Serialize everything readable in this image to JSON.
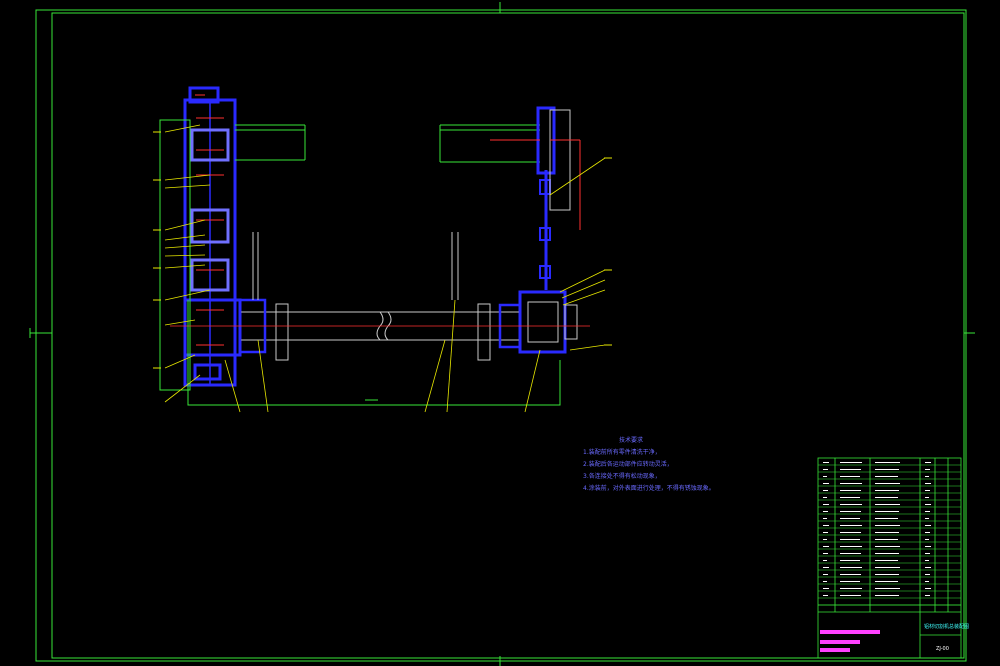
{
  "drawing": {
    "background": "#000000",
    "frame_color": "#39e639",
    "part_color": "#2a2aff",
    "centerline_color": "#ff2020",
    "leader_color": "#e8e800",
    "outline_color": "#c8c8c8"
  },
  "notes": {
    "title": "技术要求",
    "lines": [
      "1.装配前所有零件清洗干净，",
      "2.装配后各运动部件应转动灵活，",
      "3.各连接处不得有松动现象，",
      "4.涂装前，对外表面进行处理，不得有锈蚀现象。"
    ]
  },
  "title_block": {
    "drawing_name": "铝材切割机总装配图",
    "drawing_number": "ZJ-00",
    "header_labels": [
      "序号",
      "代号",
      "名称",
      "数量",
      "材料",
      "备注"
    ]
  },
  "icons": {
    "crosshair": "registration-mark-icon"
  }
}
